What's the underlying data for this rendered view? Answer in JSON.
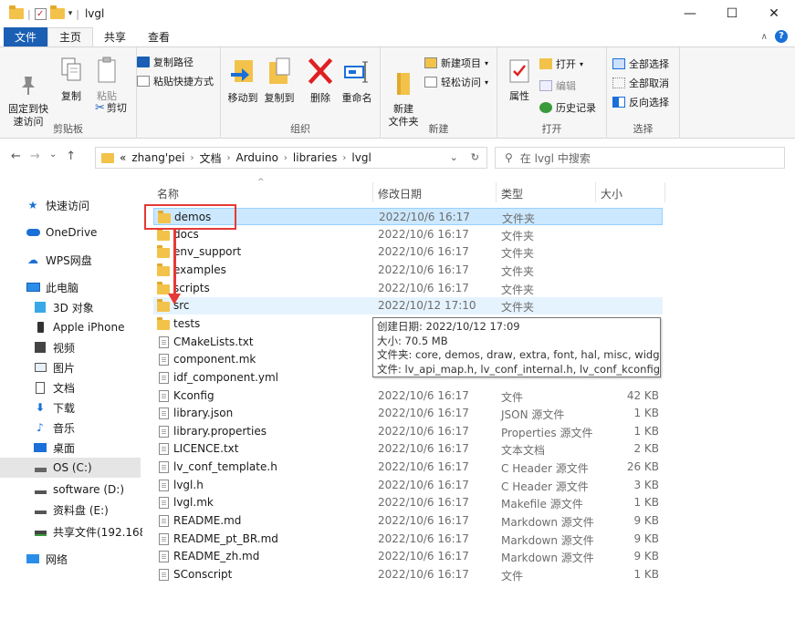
{
  "window": {
    "title": "lvgl",
    "controls": {
      "minimize": "—",
      "maximize": "☐",
      "close": "✕"
    }
  },
  "tabs": [
    {
      "label": "文件"
    },
    {
      "label": "主页"
    },
    {
      "label": "共享"
    },
    {
      "label": "查看"
    }
  ],
  "ribbon": {
    "clipboard": {
      "label": "剪贴板",
      "pin": "固定到快\n速访问",
      "copy": "复制",
      "paste": "粘贴",
      "copy_path": "复制路径",
      "paste_shortcut": "粘贴快捷方式",
      "cut": "剪切"
    },
    "organize": {
      "label": "组织",
      "move_to": "移动到",
      "copy_to": "复制到",
      "delete": "删除",
      "rename": "重命名"
    },
    "new": {
      "label": "新建",
      "new_folder": "新建\n文件夹",
      "new_item": "新建项目",
      "easy_access": "轻松访问"
    },
    "open": {
      "label": "打开",
      "properties": "属性",
      "open": "打开",
      "edit": "编辑",
      "history": "历史记录"
    },
    "select": {
      "label": "选择",
      "select_all": "全部选择",
      "select_none": "全部取消",
      "invert": "反向选择"
    }
  },
  "address": {
    "prefix": "«",
    "crumbs": [
      "zhang'pei",
      "文档",
      "Arduino",
      "libraries",
      "lvgl"
    ],
    "search_placeholder": "在 lvgl 中搜索"
  },
  "sidebar": {
    "items": [
      {
        "label": "快速访问",
        "icon": "star-icon"
      },
      {
        "label": "OneDrive",
        "icon": "cloud-icon"
      },
      {
        "label": "WPS网盘",
        "icon": "wps-cloud-icon"
      },
      {
        "label": "此电脑",
        "icon": "computer-icon"
      },
      {
        "label": "3D 对象",
        "icon": "cube-icon"
      },
      {
        "label": "Apple iPhone",
        "icon": "phone-icon"
      },
      {
        "label": "视频",
        "icon": "video-icon"
      },
      {
        "label": "图片",
        "icon": "picture-icon"
      },
      {
        "label": "文档",
        "icon": "document-icon"
      },
      {
        "label": "下载",
        "icon": "download-icon"
      },
      {
        "label": "音乐",
        "icon": "music-icon"
      },
      {
        "label": "桌面",
        "icon": "desktop-icon"
      },
      {
        "label": "OS (C:)",
        "icon": "drive-icon"
      },
      {
        "label": "software (D:)",
        "icon": "drive-icon"
      },
      {
        "label": "资料盘 (E:)",
        "icon": "drive-icon"
      },
      {
        "label": "共享文件(192.168.(",
        "icon": "network-drive-icon"
      },
      {
        "label": "网络",
        "icon": "network-icon"
      }
    ]
  },
  "columns": {
    "name": "名称",
    "date": "修改日期",
    "type": "类型",
    "size": "大小"
  },
  "files": [
    {
      "name": "demos",
      "date": "2022/10/6 16:17",
      "type": "文件夹",
      "size": "",
      "kind": "folder"
    },
    {
      "name": "docs",
      "date": "2022/10/6 16:17",
      "type": "文件夹",
      "size": "",
      "kind": "folder"
    },
    {
      "name": "env_support",
      "date": "2022/10/6 16:17",
      "type": "文件夹",
      "size": "",
      "kind": "folder"
    },
    {
      "name": "examples",
      "date": "2022/10/6 16:17",
      "type": "文件夹",
      "size": "",
      "kind": "folder"
    },
    {
      "name": "scripts",
      "date": "2022/10/6 16:17",
      "type": "文件夹",
      "size": "",
      "kind": "folder"
    },
    {
      "name": "src",
      "date": "2022/10/12 17:10",
      "type": "文件夹",
      "size": "",
      "kind": "folder"
    },
    {
      "name": "tests",
      "date": "",
      "type": "",
      "size": "",
      "kind": "folder"
    },
    {
      "name": "CMakeLists.txt",
      "date": "",
      "type": "",
      "size": "",
      "kind": "doc"
    },
    {
      "name": "component.mk",
      "date": "",
      "type": "",
      "size": "",
      "kind": "doc"
    },
    {
      "name": "idf_component.yml",
      "date": "",
      "type": "",
      "size": "",
      "kind": "doc"
    },
    {
      "name": "Kconfig",
      "date": "2022/10/6 16:17",
      "type": "文件",
      "size": "42 KB",
      "kind": "doc"
    },
    {
      "name": "library.json",
      "date": "2022/10/6 16:17",
      "type": "JSON 源文件",
      "size": "1 KB",
      "kind": "doc"
    },
    {
      "name": "library.properties",
      "date": "2022/10/6 16:17",
      "type": "Properties 源文件",
      "size": "1 KB",
      "kind": "doc"
    },
    {
      "name": "LICENCE.txt",
      "date": "2022/10/6 16:17",
      "type": "文本文档",
      "size": "2 KB",
      "kind": "doc"
    },
    {
      "name": "lv_conf_template.h",
      "date": "2022/10/6 16:17",
      "type": "C Header 源文件",
      "size": "26 KB",
      "kind": "doc"
    },
    {
      "name": "lvgl.h",
      "date": "2022/10/6 16:17",
      "type": "C Header 源文件",
      "size": "3 KB",
      "kind": "doc"
    },
    {
      "name": "lvgl.mk",
      "date": "2022/10/6 16:17",
      "type": "Makefile 源文件",
      "size": "1 KB",
      "kind": "doc"
    },
    {
      "name": "README.md",
      "date": "2022/10/6 16:17",
      "type": "Markdown 源文件",
      "size": "9 KB",
      "kind": "doc"
    },
    {
      "name": "README_pt_BR.md",
      "date": "2022/10/6 16:17",
      "type": "Markdown 源文件",
      "size": "9 KB",
      "kind": "doc"
    },
    {
      "name": "README_zh.md",
      "date": "2022/10/6 16:17",
      "type": "Markdown 源文件",
      "size": "9 KB",
      "kind": "doc"
    },
    {
      "name": "SConscript",
      "date": "2022/10/6 16:17",
      "type": "文件",
      "size": "1 KB",
      "kind": "doc"
    }
  ],
  "tooltip": {
    "created": "创建日期: 2022/10/12 17:09",
    "size": "大小: 70.5 MB",
    "folders": "文件夹: core, demos, draw, extra, font, hal, misc, widgets",
    "files": "文件: lv_api_map.h, lv_conf_internal.h, lv_conf_kconfig.h, ..."
  },
  "colors": {
    "accent": "#1a5fb4",
    "folder": "#f3c24a",
    "selection": "#cce8ff",
    "annotation": "#e53935"
  }
}
